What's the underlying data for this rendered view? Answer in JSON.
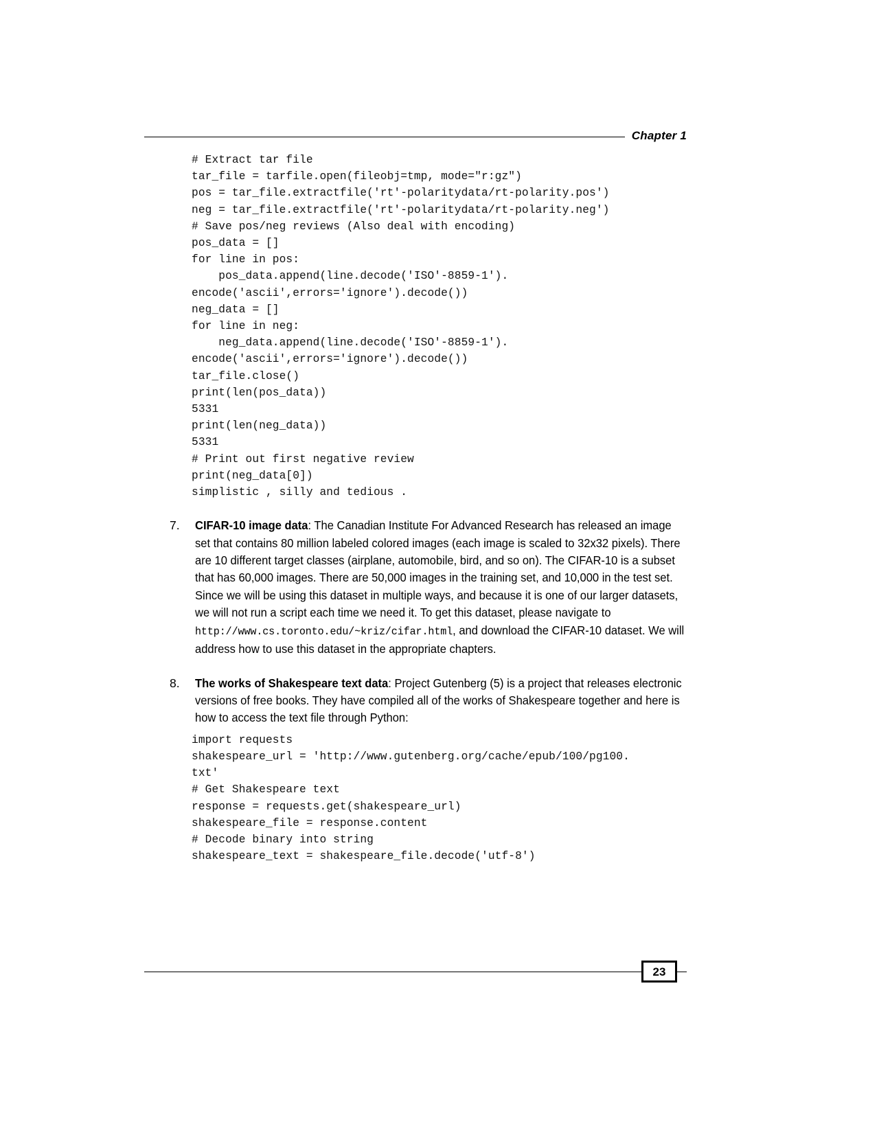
{
  "header": {
    "chapter_label": "Chapter 1"
  },
  "footer": {
    "page_number": "23"
  },
  "code_block_1": {
    "lines": [
      "# Extract tar file",
      "tar_file = tarfile.open(fileobj=tmp, mode=\"r:gz\")",
      "pos = tar_file.extractfile('rt'-polaritydata/rt-polarity.pos')",
      "neg = tar_file.extractfile('rt'-polaritydata/rt-polarity.neg')",
      "# Save pos/neg reviews (Also deal with encoding)",
      "pos_data = []",
      "for line in pos:",
      "    pos_data.append(line.decode('ISO'-8859-1').",
      "encode('ascii',errors='ignore').decode())",
      "neg_data = []",
      "for line in neg:",
      "    neg_data.append(line.decode('ISO'-8859-1').",
      "encode('ascii',errors='ignore').decode())",
      "tar_file.close()",
      "print(len(pos_data))",
      "5331",
      "print(len(neg_data))",
      "5331",
      "# Print out first negative review",
      "print(neg_data[0])",
      "simplistic , silly and tedious ."
    ]
  },
  "list_items": [
    {
      "marker": "7.",
      "lead": "CIFAR-10 image data",
      "text_part_1": ": The Canadian Institute For Advanced Research has released an image set that contains 80 million labeled colored images (each image is scaled to 32x32 pixels). There are 10 different target classes (airplane, automobile, bird, and so on). The CIFAR-10 is a subset that has 60,000 images. There are 50,000 images in the training set, and 10,000 in the test set. Since we will be using this dataset in multiple ways, and because it is one of our larger datasets, we will not run a script each time we need it. To get this dataset, please navigate to ",
      "url": "http://www.cs.toronto.edu/~kriz/cifar.html",
      "text_part_2": ", and download the CIFAR-10 dataset. We will address how to use this dataset in the appropriate chapters."
    },
    {
      "marker": "8.",
      "lead": "The works of Shakespeare text data",
      "text_part_1": ": Project Gutenberg (5) is a project that releases electronic versions of free books. They have compiled all of the works of Shakespeare together and here is how to access the text file through Python:",
      "url": "",
      "text_part_2": ""
    }
  ],
  "code_block_2": {
    "lines": [
      "import requests",
      "shakespeare_url = 'http://www.gutenberg.org/cache/epub/100/pg100.",
      "txt'",
      "# Get Shakespeare text",
      "response = requests.get(shakespeare_url)",
      "shakespeare_file = response.content",
      "# Decode binary into string",
      "shakespeare_text = shakespeare_file.decode('utf-8')"
    ]
  }
}
